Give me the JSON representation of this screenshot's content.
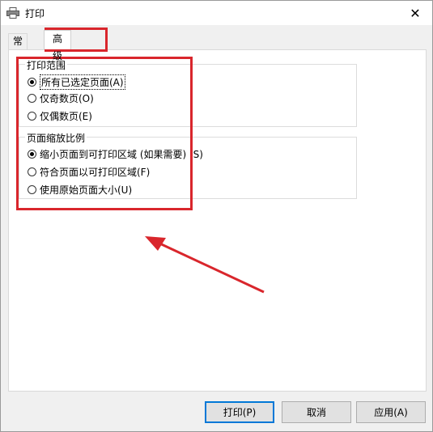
{
  "window": {
    "title": "打印",
    "close_glyph": "✕"
  },
  "tabs": [
    {
      "label": "常规",
      "selected": false
    },
    {
      "label": "高级",
      "selected": true
    }
  ],
  "groups": {
    "print_range": {
      "title": "打印范围",
      "options": [
        {
          "label": "所有已选定页面(A)",
          "checked": true
        },
        {
          "label": "仅奇数页(O)",
          "checked": false
        },
        {
          "label": "仅偶数页(E)",
          "checked": false
        }
      ]
    },
    "page_scaling": {
      "title": "页面缩放比例",
      "options": [
        {
          "label": "缩小页面到可打印区域 (如果需要) (S)",
          "checked": true
        },
        {
          "label": "符合页面以可打印区域(F)",
          "checked": false
        },
        {
          "label": "使用原始页面大小(U)",
          "checked": false
        }
      ]
    }
  },
  "buttons": {
    "print": "打印(P)",
    "cancel": "取消",
    "apply": "应用(A)"
  },
  "annotation_color": "#d9262c",
  "accent_color": "#0078d7"
}
